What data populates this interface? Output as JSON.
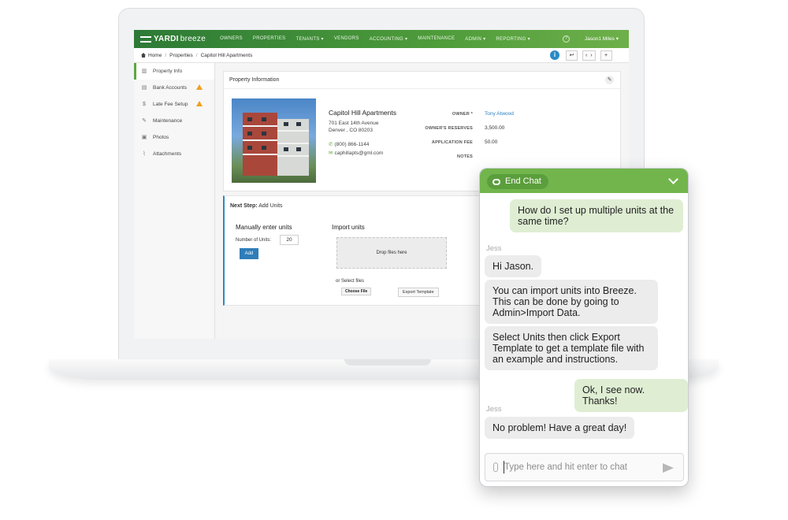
{
  "app": {
    "logo_yardi": "YARDI",
    "logo_breeze": "breeze",
    "nav": [
      "OWNERS",
      "PROPERTIES",
      "TENANTS ▾",
      "VENDORS",
      "ACCOUNTING ▾",
      "MAINTENANCE",
      "ADMIN ▾",
      "REPORTING ▾"
    ],
    "help": "?",
    "user": "Jason1 Miles ▾",
    "breadcrumb": [
      "Home",
      "Properties",
      "Capitol Hill Apartments"
    ],
    "tools": {
      "info": "i",
      "back": "↩",
      "prev": "‹",
      "next": "›",
      "add": "+"
    },
    "sidebar": [
      {
        "label": "Property Info",
        "icon": "building-icon",
        "glyph": "▥"
      },
      {
        "label": "Bank Accounts",
        "icon": "bank-icon",
        "glyph": "▤"
      },
      {
        "label": "Late Fee Setup",
        "icon": "dollar-icon",
        "glyph": "$"
      },
      {
        "label": "Maintenance",
        "icon": "wrench-icon",
        "glyph": "✎"
      },
      {
        "label": "Photos",
        "icon": "image-icon",
        "glyph": "▣"
      },
      {
        "label": "Attachments",
        "icon": "paperclip-icon",
        "glyph": "⌇"
      }
    ],
    "collapse": "‹",
    "property_panel": {
      "title": "Property Information",
      "name": "Capitol Hill Apartments",
      "address1": "701 East 14th Avenue",
      "address2": "Denver , CO 80203",
      "phone": "(800) 866-1144",
      "email": "caphillapts@gml.com",
      "fields": [
        {
          "label": "OWNER *",
          "value": "Tony Atwood"
        },
        {
          "label": "OWNER'S RESERVES",
          "value": "3,500.00"
        },
        {
          "label": "APPLICATION FEE",
          "value": "50.00"
        },
        {
          "label": "NOTES",
          "value": ""
        }
      ]
    },
    "next_step": {
      "prefix": "Next Step:",
      "title": "Add Units",
      "manual_heading": "Manually enter units",
      "units_label": "Number of Units:",
      "units_value": "20",
      "add_button": "Add",
      "import_heading": "Import units",
      "drop_text": "Drop files here",
      "or_select": "or Select files",
      "choose_file": "Choose File",
      "export_template": "Export Template"
    }
  },
  "chat": {
    "header_button": "End Chat",
    "agent_name": "Jess",
    "messages": [
      {
        "from": "user",
        "text": "How do I set up multiple units at the same time?"
      },
      {
        "from": "agent",
        "text": "Hi Jason."
      },
      {
        "from": "agent",
        "text": "You can import units into Breeze. This can be done by going to Admin>Import Data."
      },
      {
        "from": "agent",
        "text": "Select Units then click Export Template to get a template file with an example and instructions."
      },
      {
        "from": "user",
        "text": "Ok, I see now. Thanks!"
      },
      {
        "from": "agent",
        "text": "No problem! Have a great day!"
      }
    ],
    "input_placeholder": "Type here and hit enter to chat"
  },
  "colors": {
    "brand_green": "#4d9b3a",
    "chat_green": "#72b54d",
    "link_blue": "#2a7fc0",
    "warning": "#f0a020"
  }
}
